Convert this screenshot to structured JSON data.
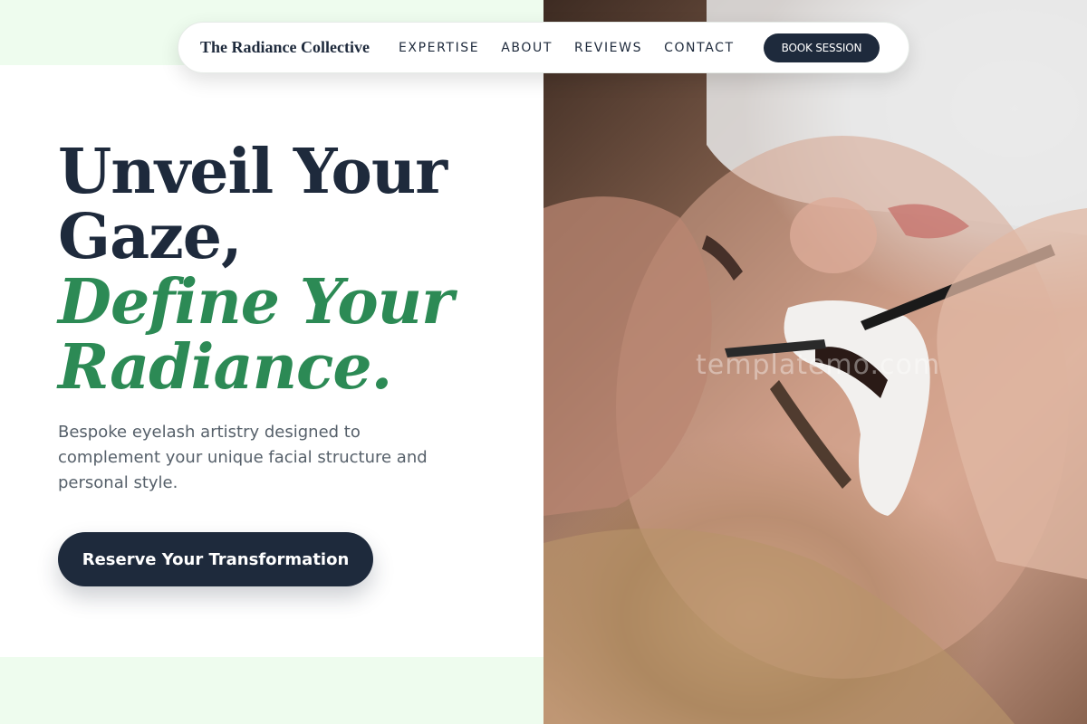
{
  "nav": {
    "brand": "The Radiance Collective",
    "links": [
      "EXPERTISE",
      "ABOUT",
      "REVIEWS",
      "CONTACT"
    ],
    "book_label": "BOOK SESSION"
  },
  "hero": {
    "headline_line1": "Unveil Your",
    "headline_line2": "Gaze,",
    "accent_line1": "Define Your",
    "accent_line2": "Radiance.",
    "subtitle": "Bespoke eyelash artistry designed to complement your unique facial structure and personal style.",
    "cta_label": "Reserve Your Transformation"
  },
  "image": {
    "watermark": "templatemo.com"
  },
  "colors": {
    "navy": "#1e2a3c",
    "accent_green": "#2c8a55",
    "mint_band": "#eefcee",
    "body_text": "#56606a"
  }
}
